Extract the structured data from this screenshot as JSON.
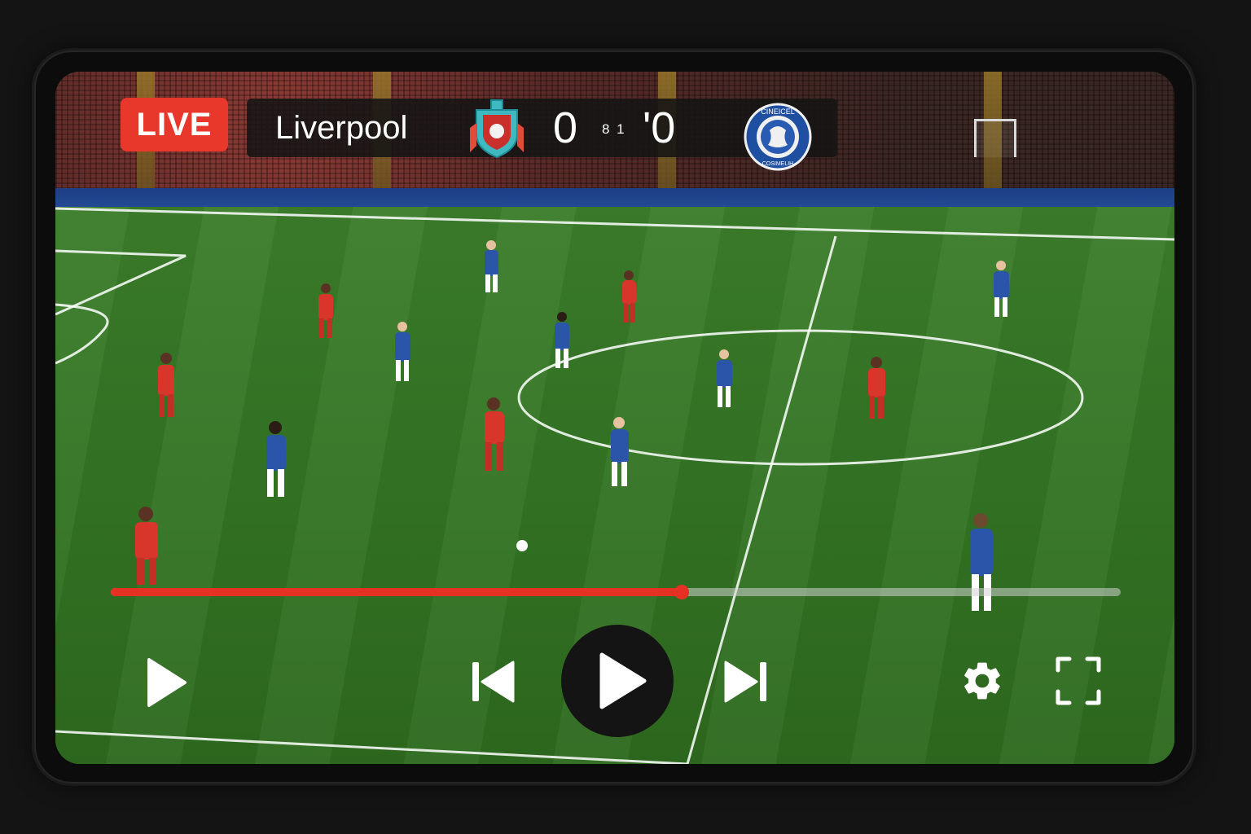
{
  "broadcast": {
    "live_label": "LIVE",
    "home_team": "Liverpool",
    "home_score": "0",
    "middle_text": "8 1",
    "away_score": "'0",
    "away_crest_text_top": "CINEICEL",
    "away_crest_text_bottom": "COSIMELIH"
  },
  "playback": {
    "progress": 0.565
  },
  "controls": {
    "play_icon": "play-icon",
    "previous_icon": "skip-previous-icon",
    "center_play_icon": "play-icon",
    "next_icon": "skip-next-icon",
    "settings_icon": "gear-icon",
    "fullscreen_icon": "fullscreen-icon"
  },
  "colors": {
    "live_red": "#e8372b",
    "progress_red": "#e53124",
    "home_kit": "#d8362a",
    "away_kit": "#2a55a8"
  }
}
